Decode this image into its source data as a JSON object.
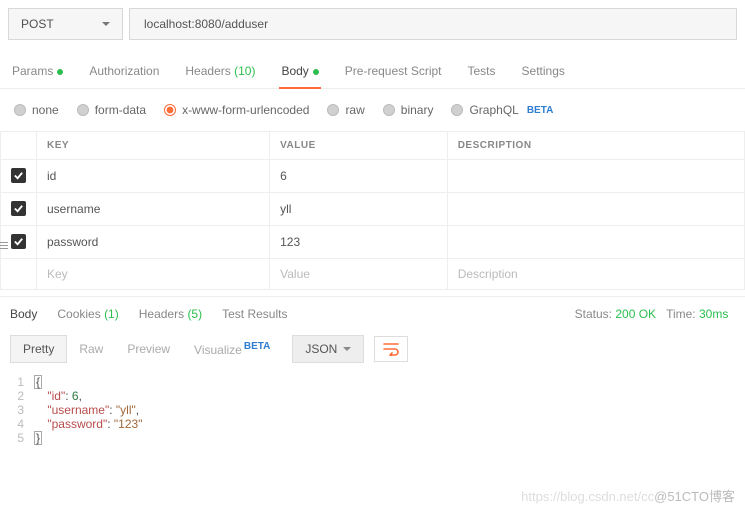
{
  "request": {
    "method": "POST",
    "url": "localhost:8080/adduser"
  },
  "tabs": {
    "params": "Params",
    "authorization": "Authorization",
    "headers": "Headers",
    "headers_count": "(10)",
    "body": "Body",
    "prerequest": "Pre-request Script",
    "tests": "Tests",
    "settings": "Settings"
  },
  "body_types": {
    "none": "none",
    "formdata": "form-data",
    "urlencoded": "x-www-form-urlencoded",
    "raw": "raw",
    "binary": "binary",
    "graphql": "GraphQL",
    "beta": "BETA"
  },
  "table": {
    "headers": {
      "key": "KEY",
      "value": "VALUE",
      "desc": "DESCRIPTION"
    },
    "rows": [
      {
        "key": "id",
        "value": "6"
      },
      {
        "key": "username",
        "value": "yll"
      },
      {
        "key": "password",
        "value": "123"
      }
    ],
    "placeholder": {
      "key": "Key",
      "value": "Value",
      "desc": "Description"
    }
  },
  "response_tabs": {
    "body": "Body",
    "cookies": "Cookies",
    "cookies_count": "(1)",
    "headers": "Headers",
    "headers_count": "(5)",
    "testresults": "Test Results",
    "status_label": "Status:",
    "status_value": "200 OK",
    "time_label": "Time:",
    "time_value": "30ms"
  },
  "view": {
    "pretty": "Pretty",
    "raw": "Raw",
    "preview": "Preview",
    "visualize": "Visualize",
    "beta": "BETA",
    "format": "JSON"
  },
  "response_body": {
    "lines": [
      "1",
      "2",
      "3",
      "4",
      "5"
    ],
    "id_value": "6",
    "username_value": "\"yll\"",
    "password_value": "\"123\""
  },
  "watermark": {
    "a": "https://blog.csdn.net/cc",
    "b": "@51CTO博客"
  }
}
